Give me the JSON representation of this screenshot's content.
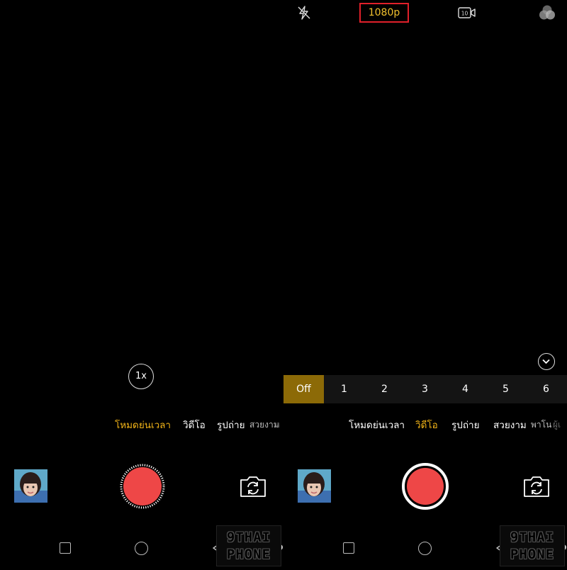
{
  "top_bar": {
    "resolution": "1080p",
    "flash_icon": "flash-off-icon",
    "timer_icon": "timer-10-video-icon",
    "filter_icon": "filter-icon",
    "highlight_color": "#e0202a",
    "accent_color": "#f2b418"
  },
  "left_panel": {
    "zoom_label": "1x",
    "modes": [
      {
        "label": "โหมดย่นเวลา",
        "active": true
      },
      {
        "label": "วิดีโอ",
        "active": false
      },
      {
        "label": "รูปถ่าย",
        "active": false
      },
      {
        "label": "สวยงาม",
        "active": false
      },
      {
        "label": "ห",
        "active": false
      }
    ]
  },
  "right_panel": {
    "speed_options": [
      "Off",
      "1",
      "2",
      "3",
      "4",
      "5",
      "6"
    ],
    "speed_selected": "Off",
    "modes": [
      {
        "label": "โหมดย่นเวลา",
        "active": false
      },
      {
        "label": "วิดีโอ",
        "active": true
      },
      {
        "label": "รูปถ่าย",
        "active": false
      },
      {
        "label": "สวยงาม",
        "active": false
      },
      {
        "label": "พาโน",
        "active": false
      },
      {
        "label": "ผู้เ",
        "active": false
      }
    ],
    "record_color": "#ee4747"
  },
  "watermark": {
    "line1": "9THAI",
    "line2": "PHONE"
  }
}
